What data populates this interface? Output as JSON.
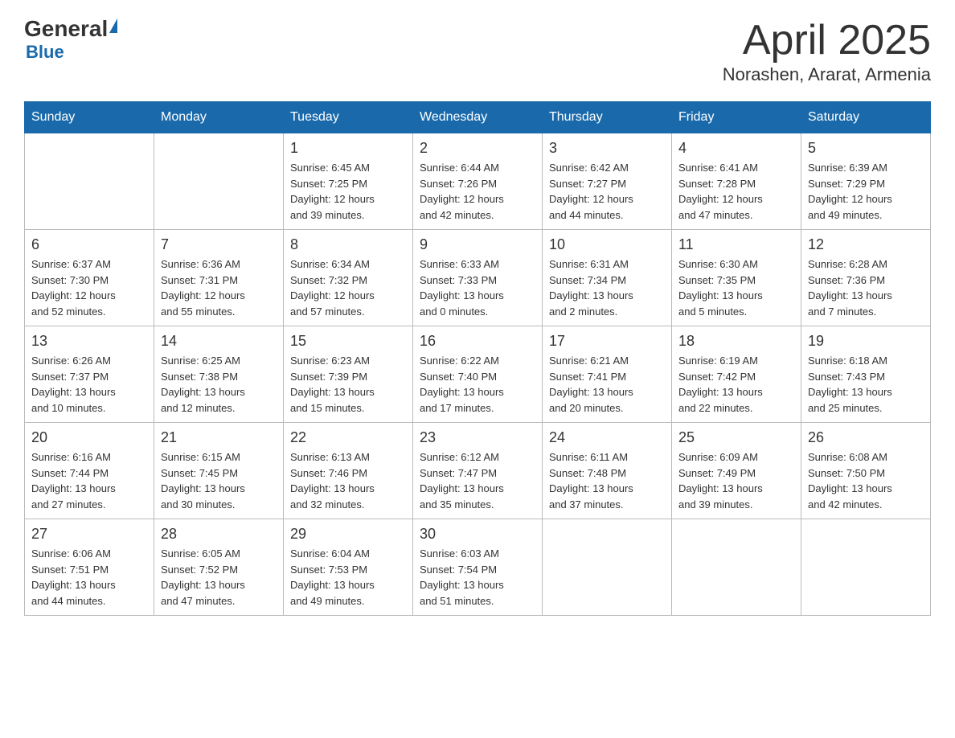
{
  "header": {
    "logo": {
      "general": "General",
      "blue": "Blue",
      "triangle": "▲"
    },
    "title": "April 2025",
    "location": "Norashen, Ararat, Armenia"
  },
  "calendar": {
    "days_of_week": [
      "Sunday",
      "Monday",
      "Tuesday",
      "Wednesday",
      "Thursday",
      "Friday",
      "Saturday"
    ],
    "weeks": [
      [
        {
          "day": "",
          "info": ""
        },
        {
          "day": "",
          "info": ""
        },
        {
          "day": "1",
          "info": "Sunrise: 6:45 AM\nSunset: 7:25 PM\nDaylight: 12 hours\nand 39 minutes."
        },
        {
          "day": "2",
          "info": "Sunrise: 6:44 AM\nSunset: 7:26 PM\nDaylight: 12 hours\nand 42 minutes."
        },
        {
          "day": "3",
          "info": "Sunrise: 6:42 AM\nSunset: 7:27 PM\nDaylight: 12 hours\nand 44 minutes."
        },
        {
          "day": "4",
          "info": "Sunrise: 6:41 AM\nSunset: 7:28 PM\nDaylight: 12 hours\nand 47 minutes."
        },
        {
          "day": "5",
          "info": "Sunrise: 6:39 AM\nSunset: 7:29 PM\nDaylight: 12 hours\nand 49 minutes."
        }
      ],
      [
        {
          "day": "6",
          "info": "Sunrise: 6:37 AM\nSunset: 7:30 PM\nDaylight: 12 hours\nand 52 minutes."
        },
        {
          "day": "7",
          "info": "Sunrise: 6:36 AM\nSunset: 7:31 PM\nDaylight: 12 hours\nand 55 minutes."
        },
        {
          "day": "8",
          "info": "Sunrise: 6:34 AM\nSunset: 7:32 PM\nDaylight: 12 hours\nand 57 minutes."
        },
        {
          "day": "9",
          "info": "Sunrise: 6:33 AM\nSunset: 7:33 PM\nDaylight: 13 hours\nand 0 minutes."
        },
        {
          "day": "10",
          "info": "Sunrise: 6:31 AM\nSunset: 7:34 PM\nDaylight: 13 hours\nand 2 minutes."
        },
        {
          "day": "11",
          "info": "Sunrise: 6:30 AM\nSunset: 7:35 PM\nDaylight: 13 hours\nand 5 minutes."
        },
        {
          "day": "12",
          "info": "Sunrise: 6:28 AM\nSunset: 7:36 PM\nDaylight: 13 hours\nand 7 minutes."
        }
      ],
      [
        {
          "day": "13",
          "info": "Sunrise: 6:26 AM\nSunset: 7:37 PM\nDaylight: 13 hours\nand 10 minutes."
        },
        {
          "day": "14",
          "info": "Sunrise: 6:25 AM\nSunset: 7:38 PM\nDaylight: 13 hours\nand 12 minutes."
        },
        {
          "day": "15",
          "info": "Sunrise: 6:23 AM\nSunset: 7:39 PM\nDaylight: 13 hours\nand 15 minutes."
        },
        {
          "day": "16",
          "info": "Sunrise: 6:22 AM\nSunset: 7:40 PM\nDaylight: 13 hours\nand 17 minutes."
        },
        {
          "day": "17",
          "info": "Sunrise: 6:21 AM\nSunset: 7:41 PM\nDaylight: 13 hours\nand 20 minutes."
        },
        {
          "day": "18",
          "info": "Sunrise: 6:19 AM\nSunset: 7:42 PM\nDaylight: 13 hours\nand 22 minutes."
        },
        {
          "day": "19",
          "info": "Sunrise: 6:18 AM\nSunset: 7:43 PM\nDaylight: 13 hours\nand 25 minutes."
        }
      ],
      [
        {
          "day": "20",
          "info": "Sunrise: 6:16 AM\nSunset: 7:44 PM\nDaylight: 13 hours\nand 27 minutes."
        },
        {
          "day": "21",
          "info": "Sunrise: 6:15 AM\nSunset: 7:45 PM\nDaylight: 13 hours\nand 30 minutes."
        },
        {
          "day": "22",
          "info": "Sunrise: 6:13 AM\nSunset: 7:46 PM\nDaylight: 13 hours\nand 32 minutes."
        },
        {
          "day": "23",
          "info": "Sunrise: 6:12 AM\nSunset: 7:47 PM\nDaylight: 13 hours\nand 35 minutes."
        },
        {
          "day": "24",
          "info": "Sunrise: 6:11 AM\nSunset: 7:48 PM\nDaylight: 13 hours\nand 37 minutes."
        },
        {
          "day": "25",
          "info": "Sunrise: 6:09 AM\nSunset: 7:49 PM\nDaylight: 13 hours\nand 39 minutes."
        },
        {
          "day": "26",
          "info": "Sunrise: 6:08 AM\nSunset: 7:50 PM\nDaylight: 13 hours\nand 42 minutes."
        }
      ],
      [
        {
          "day": "27",
          "info": "Sunrise: 6:06 AM\nSunset: 7:51 PM\nDaylight: 13 hours\nand 44 minutes."
        },
        {
          "day": "28",
          "info": "Sunrise: 6:05 AM\nSunset: 7:52 PM\nDaylight: 13 hours\nand 47 minutes."
        },
        {
          "day": "29",
          "info": "Sunrise: 6:04 AM\nSunset: 7:53 PM\nDaylight: 13 hours\nand 49 minutes."
        },
        {
          "day": "30",
          "info": "Sunrise: 6:03 AM\nSunset: 7:54 PM\nDaylight: 13 hours\nand 51 minutes."
        },
        {
          "day": "",
          "info": ""
        },
        {
          "day": "",
          "info": ""
        },
        {
          "day": "",
          "info": ""
        }
      ]
    ]
  }
}
